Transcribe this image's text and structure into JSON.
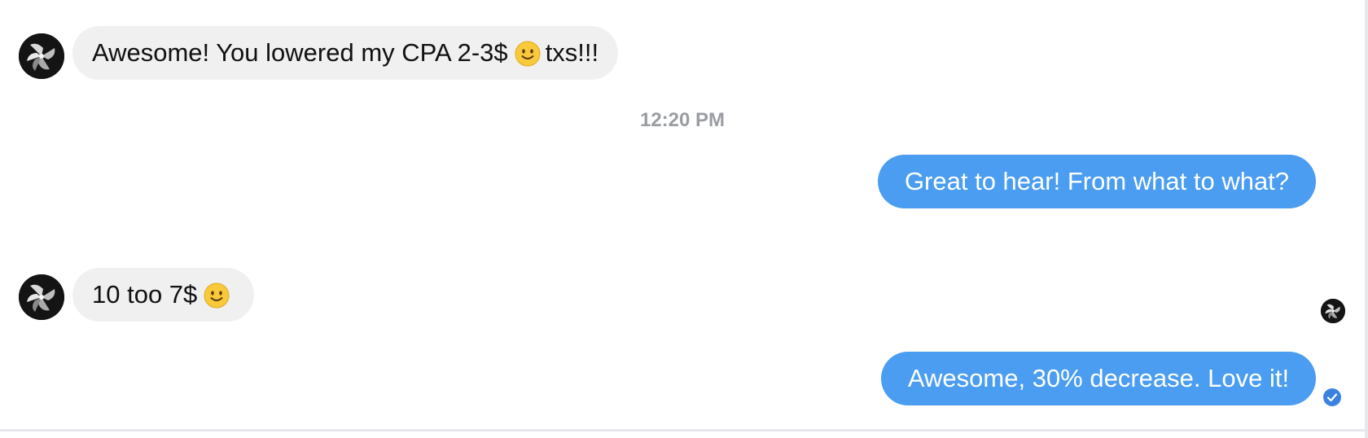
{
  "conversation": {
    "messages": [
      {
        "direction": "incoming",
        "avatar_icon": "contact-avatar-icon",
        "text_before_emoji": "Awesome! You lowered my CPA 2-3$",
        "emoji": "slightly-smiling-face-emoji",
        "text_after_emoji": "txs!!!"
      },
      {
        "direction": "timestamp",
        "text": "12:20 PM"
      },
      {
        "direction": "outgoing",
        "text": "Great to hear! From what to what?"
      },
      {
        "direction": "incoming",
        "avatar_icon": "contact-avatar-icon",
        "text_before_emoji": "10 too 7$",
        "emoji": "slightly-smiling-face-emoji",
        "text_after_emoji": ""
      },
      {
        "direction": "outgoing",
        "text": "Awesome, 30% decrease. Love it!",
        "seen_by_avatar_icon": "seen-avatar-icon",
        "status_icon": "delivered-check-icon"
      }
    ]
  },
  "colors": {
    "incoming_bubble": "#f0f0f0",
    "outgoing_bubble": "#4a9df0",
    "timestamp_text": "#9a9da2",
    "status_icon": "#3b82e0"
  }
}
